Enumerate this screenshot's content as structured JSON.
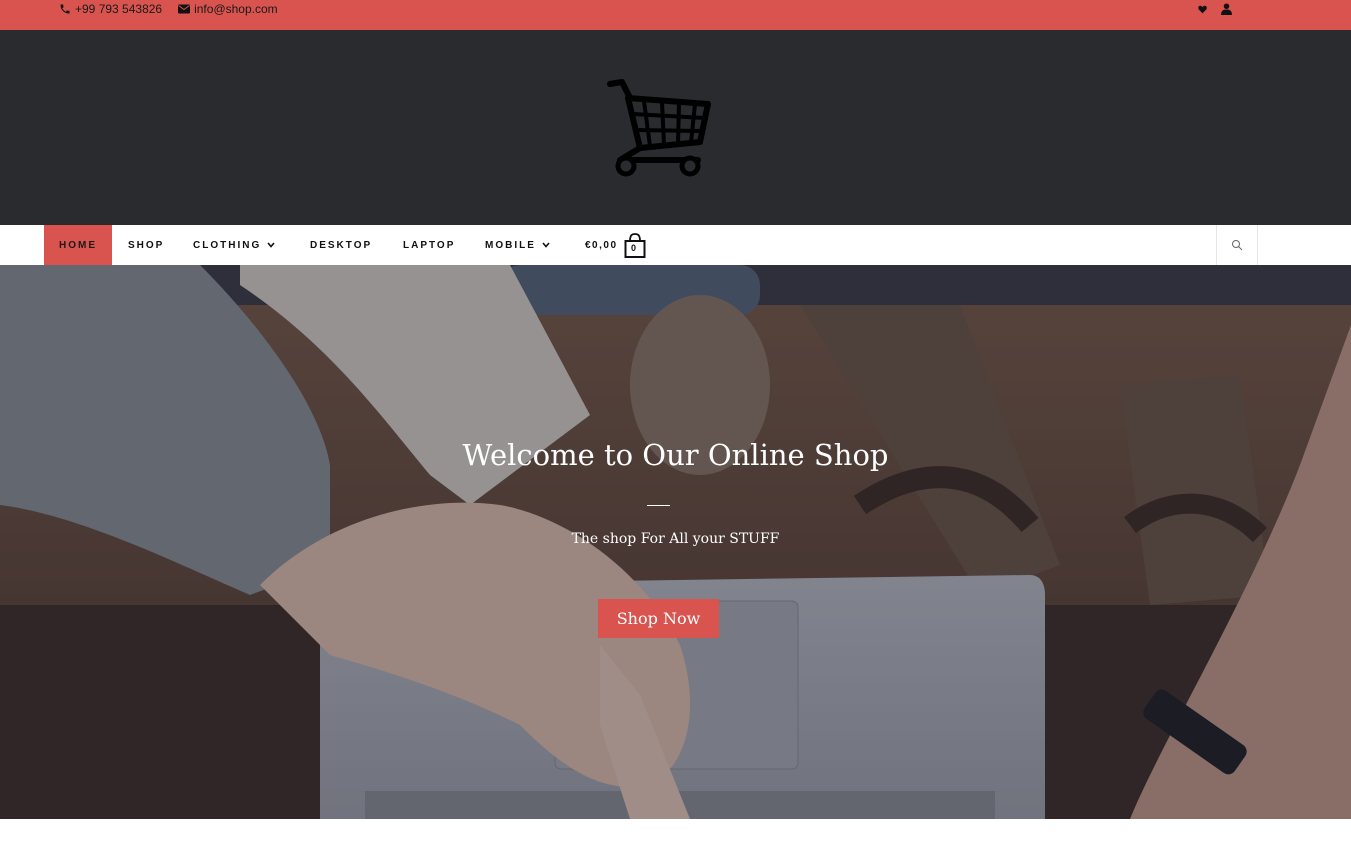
{
  "topbar": {
    "phone": "+99 793 543826",
    "email": "info@shop.com",
    "icons": [
      "phone-icon",
      "envelope-icon",
      "heart-icon",
      "user-icon"
    ],
    "color": "#d9534f"
  },
  "header": {
    "logo_icon": "shopping-cart-icon",
    "background": "#2a2b2e"
  },
  "nav": {
    "items": [
      {
        "label": "HOME",
        "active": true
      },
      {
        "label": "SHOP"
      },
      {
        "label": "CLOTHING",
        "has_dropdown": true
      },
      {
        "label": "DESKTOP"
      },
      {
        "label": "LAPTOP"
      },
      {
        "label": "MOBILE",
        "has_dropdown": true
      }
    ],
    "cart_total": "€0,00",
    "cart_count": "0",
    "search_icon": "search-icon",
    "accent": "#d9534f"
  },
  "hero": {
    "title": "Welcome to Our Online Shop",
    "subtitle": "The shop For All your STUFF",
    "button_label": "Shop Now"
  }
}
